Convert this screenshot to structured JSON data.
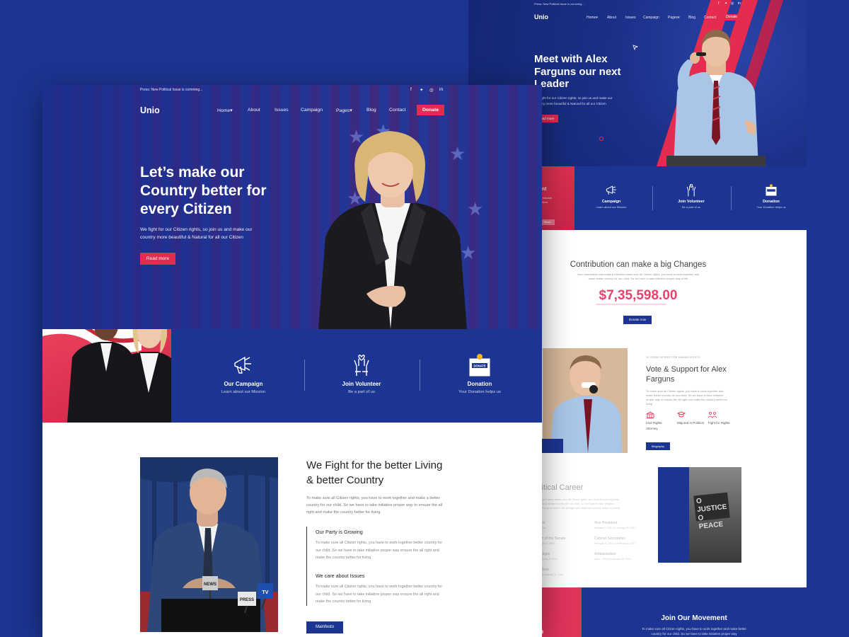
{
  "colors": {
    "brand_blue": "#1c3592",
    "accent_red": "#e52b50",
    "amount_pink": "#e6426b"
  },
  "back": {
    "topbar_text": "Press: New Political Issue is comming...",
    "logo": "Unio",
    "nav": [
      "Home▾",
      "About",
      "Issues",
      "Campaign",
      "Pages▾",
      "Blog",
      "Contact"
    ],
    "donate": "Donate",
    "hero_title": "Meet with Alex Farguns our next Leader",
    "hero_sub": "We fight for our Citizen rights, so join us and make our country more beautiful & Natural for all our Citizen",
    "read_more": "Read more",
    "red_panel": {
      "title": "ent",
      "text": "ur Mission\nCitizen",
      "btn": "Send"
    },
    "features": [
      {
        "title": "Campaign",
        "sub": "Learn about our Mission",
        "icon": "megaphone-icon"
      },
      {
        "title": "Join Volunteer",
        "sub": "Be a part of us",
        "icon": "raised-hands-icon"
      },
      {
        "title": "Donation",
        "sub": "Your Donation helps us",
        "icon": "donation-box-icon"
      }
    ],
    "contribution": {
      "title": "Contribution can make a big Changes",
      "text": "Your contribution can make a effective make sure all Citizen rights, you have to work together and make better country for our child. So we have to take initiative proper way of life",
      "amount": "$7,35,598.00",
      "button": "Donate now"
    },
    "vote": {
      "kicker": "10 YEARS WORKS FOR HUMAN RIGHTS",
      "title": "Vote & Support for Alex Farguns",
      "text": "To make sure all Citizen rights, you have to work together and make better country for our child. So we have to take initiative proper way to ensure the all right and make the country better for living",
      "items": [
        {
          "label": "Civil Rights Attorney",
          "icon": "courthouse-icon"
        },
        {
          "label": "Majored in Political",
          "icon": "graduation-icon"
        },
        {
          "label": "Fight for Rights",
          "icon": "people-icon"
        }
      ],
      "button": "Biography"
    },
    "career": {
      "title": "olitical Career",
      "text": "Political Career make sure all Citizen rights, you have to work together and make better country for our child. So we have to take initiative proper way to ensure the all right and make the country better for living",
      "items": [
        {
          "title": "sident",
          "date": "in At now"
        },
        {
          "title": "Vice President",
          "date": "February 9, 2013 to January 29, 2015"
        },
        {
          "title": "mber of the Senate",
          "date": "February 9, 2020"
        },
        {
          "title": "Cabinet Secretaries",
          "date": "February 9, 2013 to February 5, 2017"
        },
        {
          "title": "d Judges",
          "date": "to February 9, 2015"
        },
        {
          "title": "Ambassadors",
          "date": "April 7, 2019 to January 20, 2020"
        },
        {
          "title": "ic Affairs",
          "date": "2013 to January 11, 2015"
        }
      ],
      "sign_text": "O JUSTICE O PEACE"
    },
    "join": {
      "title": "Join Our Movement",
      "text": "To make sure all Citizen rights, you have to work together and make better country for our child. So we have to take initiative proper way",
      "side_text": "to"
    }
  },
  "front": {
    "topbar_text": "Press: New Political Issue is comming...",
    "logo": "Unio",
    "nav": [
      "Home▾",
      "About",
      "Issues",
      "Campaign",
      "Pages▾",
      "Blog",
      "Contact"
    ],
    "donate": "Donate",
    "hero_title": "Let’s make our Country better for every Citizen",
    "hero_sub": "We fight for our Citizen rights, so join us and make our country more beautiful & Natural for all our Citizen",
    "read_more": "Read more",
    "features": [
      {
        "title": "Our Campaign",
        "sub": "Learn about our Mission",
        "icon": "megaphone-icon"
      },
      {
        "title": "Join Volunteer",
        "sub": "Be a part of us",
        "icon": "raised-hands-icon"
      },
      {
        "title": "Donation",
        "sub": "Your Donation helps us",
        "icon": "donation-box-icon",
        "box_label": "DONATE"
      }
    ],
    "fight": {
      "title": "We Fight for the better Living & better Country",
      "text": "To make sure all Citizen rights, you have to work together and make a better country for our child. So we have to take initiative proper way to ensure the all right and make the country better for living",
      "items": [
        {
          "title": "Our Party is Growing",
          "text": "To make sure all Citizen rights, you have to work together better country for our child. So we have to take initiative proper way ensure the all right and make the country better for living"
        },
        {
          "title": "We care about Issues",
          "text": "To make sure all Citizen rights, you have to work together better country for our child. So we have to take initiative proper way ensure the all right and make the country better for living"
        }
      ],
      "button": "Mainfesto",
      "mic_labels": [
        "NEWS",
        "PRESS",
        "TV"
      ]
    }
  }
}
